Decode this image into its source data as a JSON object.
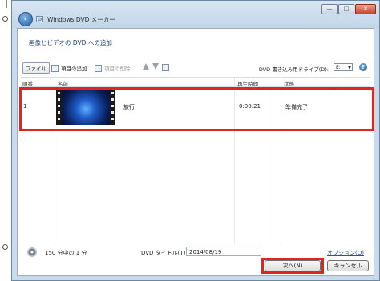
{
  "window": {
    "title": "Windows DVD メーカー"
  },
  "page": {
    "subtitle": "画像とビデオの DVD への追加"
  },
  "toolbar": {
    "file_label": "ファイル",
    "add_items_label": "項目の追加",
    "remove_items_label": "項目の削除",
    "drive_label": "DVD 書き込み用ドライブ(D):",
    "drive_value": "E:"
  },
  "list": {
    "columns": [
      "順番",
      "名前",
      "再生時間",
      "状態"
    ],
    "rows": [
      {
        "order": "1",
        "name": "旅行",
        "duration": "0:00:21",
        "status": "準備完了"
      }
    ]
  },
  "footer": {
    "usage": "150 分中の 1 分",
    "dvd_title_label": "DVD タイトル(T):",
    "dvd_title_value": "2014/08/19",
    "options_link": "オプション(O)",
    "next_button": "次へ(N)",
    "cancel_button": "キャンセル"
  },
  "colors": {
    "highlight": "#e0241e",
    "link": "#1a56b8"
  }
}
